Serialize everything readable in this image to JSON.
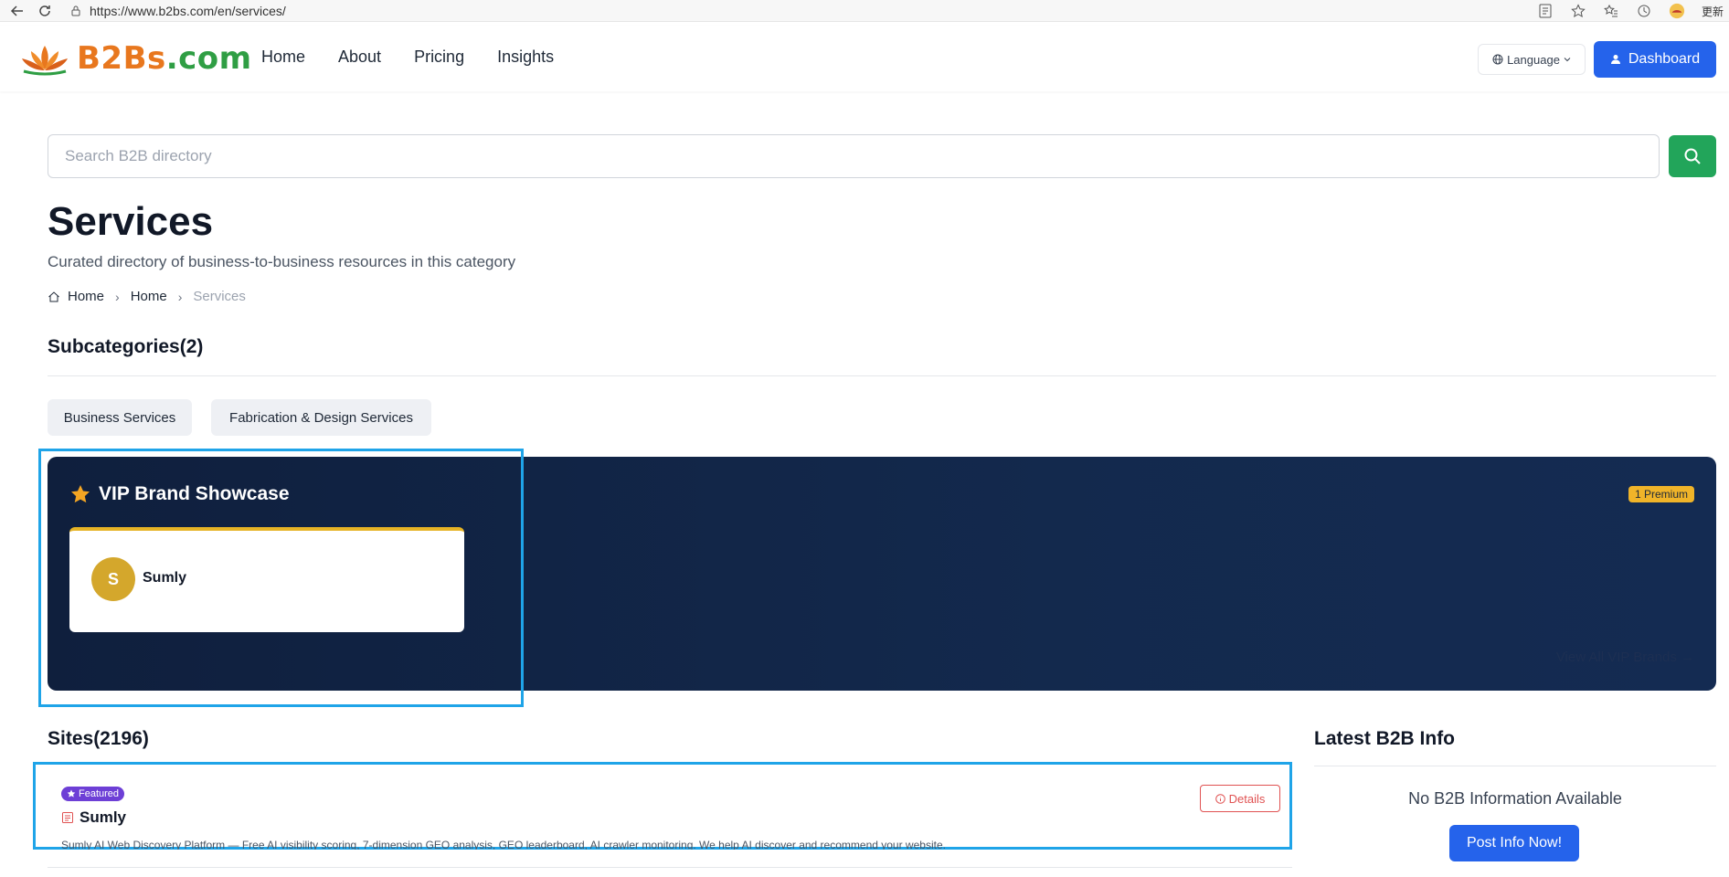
{
  "browser": {
    "url": "https://www.b2bs.com/en/services/",
    "update_label": "更新"
  },
  "header": {
    "logo_main": "B2Bs",
    "logo_suffix": ".com",
    "nav": [
      "Home",
      "About",
      "Pricing",
      "Insights"
    ],
    "language_label": "Language",
    "dashboard_label": "Dashboard"
  },
  "search": {
    "placeholder": "Search B2B directory"
  },
  "page": {
    "title": "Services",
    "subtitle": "Curated directory of business-to-business resources in this category",
    "breadcrumb": [
      "Home",
      "Home",
      "Services"
    ]
  },
  "subcategories": {
    "title": "Subcategories(2)",
    "items": [
      "Business Services",
      "Fabrication & Design Services"
    ]
  },
  "vip": {
    "title": "VIP Brand Showcase",
    "badge": "1 Premium",
    "brand_initial": "S",
    "brand_name": "Sumly",
    "view_all": "View All VIP Brands →"
  },
  "sites": {
    "title": "Sites(2196)",
    "featured_label": "Featured",
    "name": "Sumly",
    "description": "Sumly AI Web Discovery Platform — Free AI visibility scoring, 7-dimension GEO analysis, GEO leaderboard, AI crawler monitoring. We help AI discover and recommend your website.",
    "details_label": "Details"
  },
  "latest": {
    "title": "Latest B2B Info",
    "empty_text": "No B2B Information Available",
    "post_label": "Post Info Now!"
  },
  "colors": {
    "brand_orange": "#e8771e",
    "brand_green": "#2f9e44",
    "primary_blue": "#2563eb",
    "search_green": "#22a55a",
    "vip_navy": "#13294d",
    "premium_gold": "#f0b429",
    "featured_purple": "#6d3fd6",
    "details_red": "#e05252",
    "highlight_blue": "#1fa4e8"
  }
}
